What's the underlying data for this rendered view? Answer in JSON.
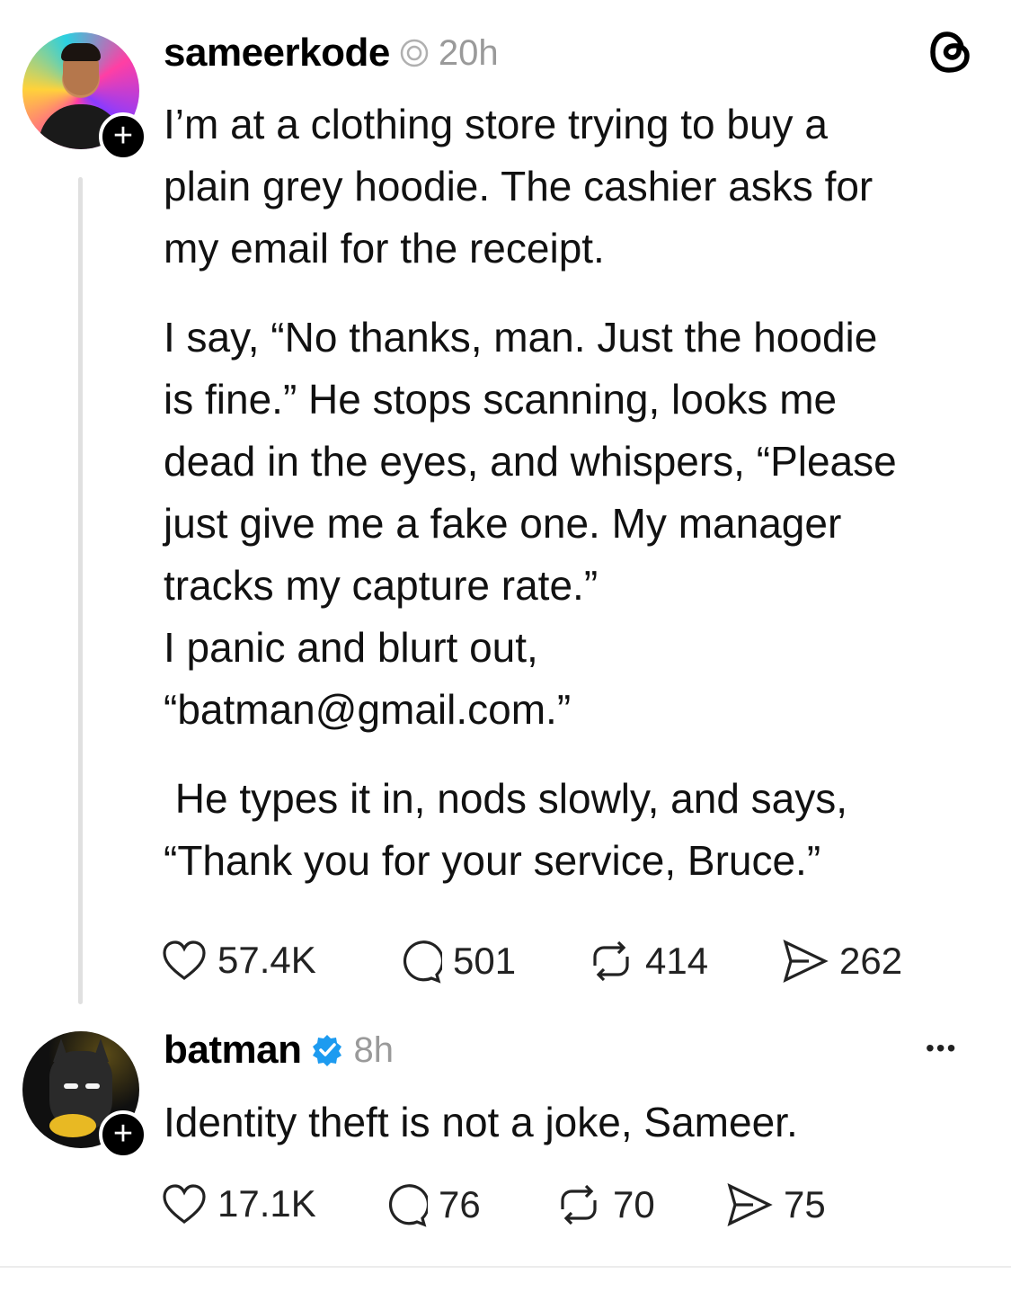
{
  "post": {
    "username": "sameerkode",
    "time": "20h",
    "paragraphs": [
      "I’m at a clothing store trying to buy a\nplain grey hoodie. The cashier asks for\nmy email for the receipt.",
      "I say, “No thanks, man. Just the hoodie\nis fine.” He stops scanning, looks me\ndead in the eyes, and whispers, “Please\njust give me a fake one. My manager\ntracks my capture rate.”\nI panic and blurt out,\n“batman@gmail.com.”",
      " He types it in, nods slowly, and says,\n“Thank you for your service, Bruce.”"
    ],
    "likes": "57.4K",
    "replies": "501",
    "reposts": "414",
    "shares": "262"
  },
  "reply": {
    "username": "batman",
    "time": "8h",
    "text": "Identity theft is not a joke, Sameer.",
    "likes": "17.1K",
    "replies": "76",
    "reposts": "70",
    "shares": "75"
  },
  "follow_symbol": "+",
  "more_symbol": "•••",
  "verified_color": "#1d9bf0",
  "icons": [
    "threads-logo-icon",
    "heart-icon",
    "comment-icon",
    "repost-icon",
    "share-icon",
    "more-icon",
    "verified-badge-icon",
    "mention-icon"
  ]
}
